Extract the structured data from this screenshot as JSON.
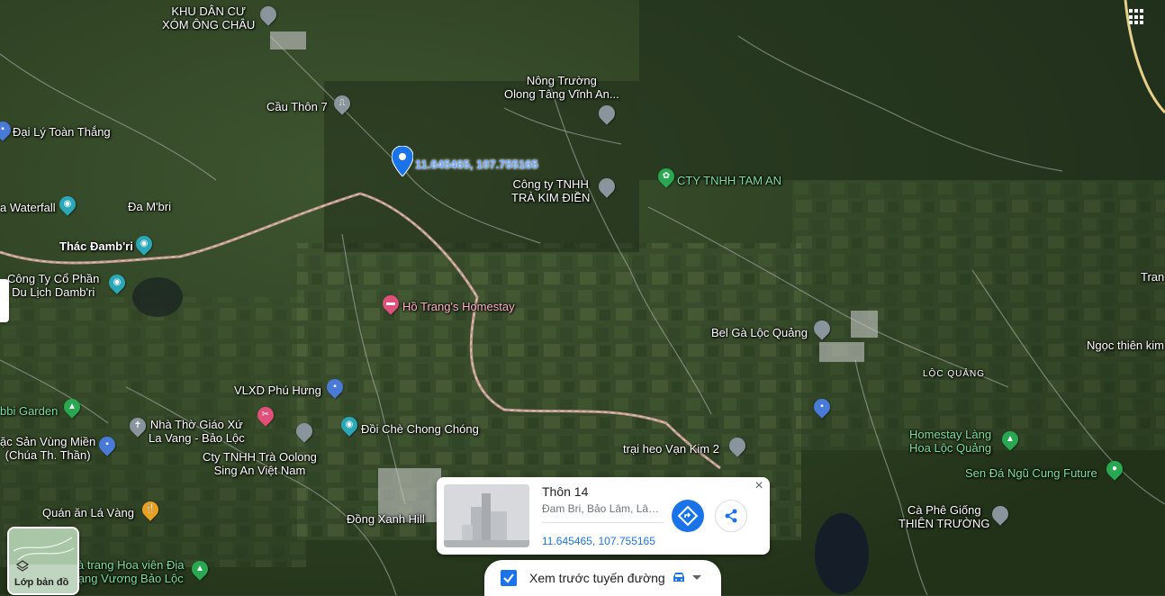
{
  "map": {
    "dropped_pin_label": "11.645465, 107.755165",
    "places": {
      "khu_dan_cu": "KHU DÂN CƯ\nXÓM ÔNG CHÂU",
      "nong_truong": "Nông Trường\nOlong Tâng Vĩnh An...",
      "cau_thon_7": "Cầu Thôn 7",
      "dai_ly": "Đại Lý Toàn Thắng",
      "waterfall": "a Waterfall",
      "da_mbri": "Đa M'bri",
      "thac_dambri": "Thác Đamb'ri",
      "cong_ty_tra": "Công ty TNHH\nTRÀ KIM ĐIỀN",
      "cty_tam_an": "CTY TNHH TAM AN",
      "cong_ty_dl": "Công Ty Cổ Phần\nDu Lịch Damb'ri",
      "homestay_ho_trang": "Hồ Trang's Homestay",
      "bel_ga": "Bel Gà Lộc Quảng",
      "tran": "Tran",
      "ngoc_thien": "Ngọc thiên kim",
      "loc_quang": "LỘC QUẢNG",
      "vlxd": "VLXD Phú Hưng",
      "bbi_garden": "bbi Garden",
      "nha_tho": "Nhà Thờ Giáo Xứ\nLa Vang - Bảo Lộc",
      "dac_san": "ặc Sản Vùng Miền\n(Chúa Th. Thần)",
      "doi_che": "Đồi Chè Chong Chóng",
      "cty_oolong": "Cty TNHH Trà Oolong\nSing An Việt Nam",
      "trai_heo": "trại heo Vạn Kim 2",
      "homestay_lang_hoa": "Homestay Làng\nHoa Lộc Quảng",
      "sen_da": "Sen Đá Ngũ Cung Future",
      "quan_an": "Quán ăn Lá Vàng",
      "dong_xanh": "Đồng Xanh Hill",
      "ca_phe": "Cà Phê Giống\nTHIÊN TRƯỜNG",
      "hoa_vien": "à trang Hoa viên Địa\nạng Vương Bảo Lộc"
    }
  },
  "layers_button": {
    "label": "Lớp bản đồ",
    "icon": "layers-icon"
  },
  "place_card": {
    "title": "Thôn 14",
    "address": "Đam Bri, Bảo Lâm, Lâm Đồng",
    "coords": "11.645465, 107.755165",
    "close_icon": "close-icon",
    "directions_icon": "directions-icon",
    "share_icon": "share-icon"
  },
  "route_preview": {
    "label": "Xem trước tuyến đường",
    "checked": true,
    "mode_icon": "car-icon"
  },
  "colors": {
    "accent": "#1a73e8",
    "road": "#d9a8a0",
    "terrain_dark": "#233520",
    "terrain_light": "#5b6d45"
  }
}
